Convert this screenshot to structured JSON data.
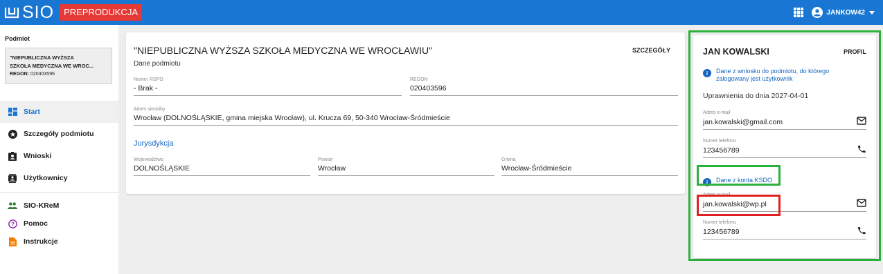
{
  "header": {
    "logo_text": "SIO",
    "env_badge": "PREPRODUKCJA",
    "user": "JANKOW42"
  },
  "sidebar": {
    "title": "Podmiot",
    "entity": {
      "name_line1": "\"NIEPUBLICZNA WYŻSZA",
      "name_line2": "SZKOŁA MEDYCZNA WE WROC...",
      "regon_label": "REGON:",
      "regon_value": "020403596"
    },
    "items": [
      {
        "label": "Start",
        "icon": "dashboard-icon",
        "active": true
      },
      {
        "label": "Szczegóły podmiotu",
        "icon": "star-circle-icon"
      },
      {
        "label": "Wnioski",
        "icon": "clipboard-account-icon"
      },
      {
        "label": "Użytkownicy",
        "icon": "contacts-icon"
      }
    ],
    "items2": [
      {
        "label": "SIO-KReM",
        "icon": "people-icon"
      },
      {
        "label": "Pomoc",
        "icon": "help-circle-icon"
      },
      {
        "label": "Instrukcje",
        "icon": "document-icon"
      }
    ]
  },
  "main": {
    "title": "\"NIEPUBLICZNA WYŻSZA SZKOŁA MEDYCZNA WE WROCŁAWIU\"",
    "subtitle": "Dane podmiotu",
    "details_btn": "SZCZEGÓŁY",
    "rspo_label": "Numer RSPO",
    "rspo_value": "- Brak -",
    "regon_label": "REGON",
    "regon_value": "020403596",
    "address_label": "Adres siedziby",
    "address_value": "Wrocław (DOLNOŚLĄSKIE, gmina miejska Wrocław), ul. Krucza 69, 50-340 Wrocław-Śródmieście",
    "jurisdiction_title": "Jurysdykcja",
    "voivodeship_label": "Województwo",
    "voivodeship_value": "DOLNOŚLĄSKIE",
    "county_label": "Powiat",
    "county_value": "Wrocław",
    "commune_label": "Gmina",
    "commune_value": "Wrocław-Śródmieście"
  },
  "profile": {
    "name": "JAN KOWALSKI",
    "profile_btn": "PROFIL",
    "info1_line1": "Dane z wniosku do podmiotu, do którego",
    "info1_line2": "zalogowany jest użytkownik",
    "permissions": "Uprawnienia do dnia 2027-04-01",
    "email1_label": "Adres e-mail",
    "email1_value": "jan.kowalski@gmail.com",
    "phone1_label": "Numer telefonu",
    "phone1_value": "123456789",
    "info2": "Dane z konta KSDO",
    "email2_label": "Adres e-mail",
    "email2_value": "jan.kowalski@wp.pl",
    "phone2_label": "Numer telefonu",
    "phone2_value": "123456789"
  },
  "colors": {
    "primary": "#1976d2",
    "badge": "#e53935",
    "highlight_green": "#2bb03a",
    "highlight_red": "#e02020"
  }
}
